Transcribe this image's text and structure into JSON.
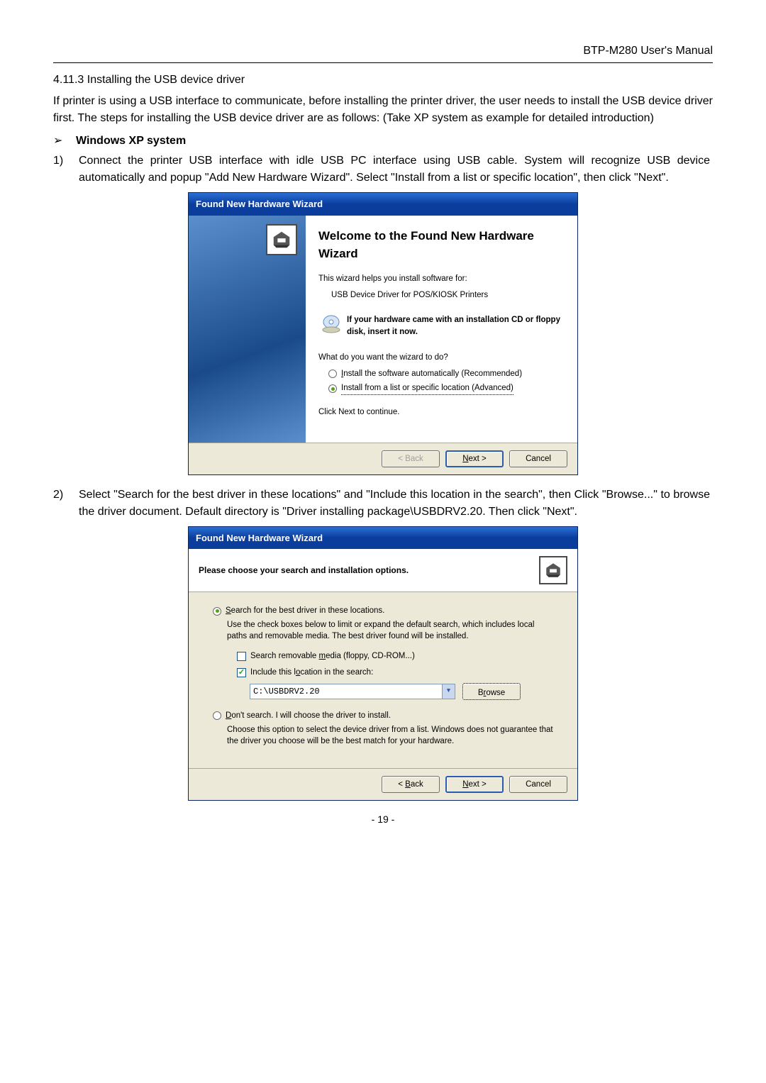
{
  "header_right": "BTP-M280 User's Manual",
  "section_heading": "4.11.3 Installing the USB device driver",
  "intro_para": "If printer is using a USB interface to communicate, before installing the printer driver, the user needs to install the USB device driver first. The steps for installing the USB device driver are as follows: (Take XP system as example for detailed introduction)",
  "bullet_sym": "➢",
  "bullet_text": "Windows XP system",
  "step1_num": "1)",
  "step1_txt": "Connect the printer USB interface with idle USB PC interface using USB cable. System will recognize USB device automatically and popup \"Add New Hardware Wizard\". Select \"Install from a list or specific location\", then click \"Next\".",
  "step2_num": "2)",
  "step2_txt": "Select \"Search for the best driver in these locations\" and \"Include this location in the search\", then Click \"Browse...\" to browse the driver document. Default directory is \"Driver installing package\\USBDRV2.20. Then click \"Next\".",
  "wizard1": {
    "title": "Found New Hardware Wizard",
    "heading": "Welcome to the Found New Hardware Wizard",
    "helps": "This wizard helps you install software for:",
    "device": "USB Device Driver for POS/KIOSK Printers",
    "cdtext": "If your hardware came with an installation CD or floppy disk, insert it now.",
    "question": "What do you want the wizard to do?",
    "opt_auto": "Install the software automatically (Recommended)",
    "opt_list": "Install from a list or specific location (Advanced)",
    "continue": "Click Next to continue.",
    "back": "< Back",
    "next": "Next >",
    "cancel": "Cancel"
  },
  "wizard2": {
    "title": "Found New Hardware Wizard",
    "header": "Please choose your search and installation options.",
    "opt_search": "Search for the best driver in these locations.",
    "desc_search": "Use the check boxes below to limit or expand the default search, which includes local paths and removable media. The best driver found will be installed.",
    "chk_removable": "Search removable media (floppy, CD-ROM...)",
    "chk_include": "Include this location in the search:",
    "path": "C:\\USBDRV2.20",
    "browse": "Browse",
    "opt_dont": "Don't search. I will choose the driver to install.",
    "desc_dont": "Choose this option to select the device driver from a list. Windows does not guarantee that the driver you choose will be the best match for your hardware.",
    "back": "< Back",
    "next": "Next >",
    "cancel": "Cancel"
  },
  "page_num": "- 19 -"
}
